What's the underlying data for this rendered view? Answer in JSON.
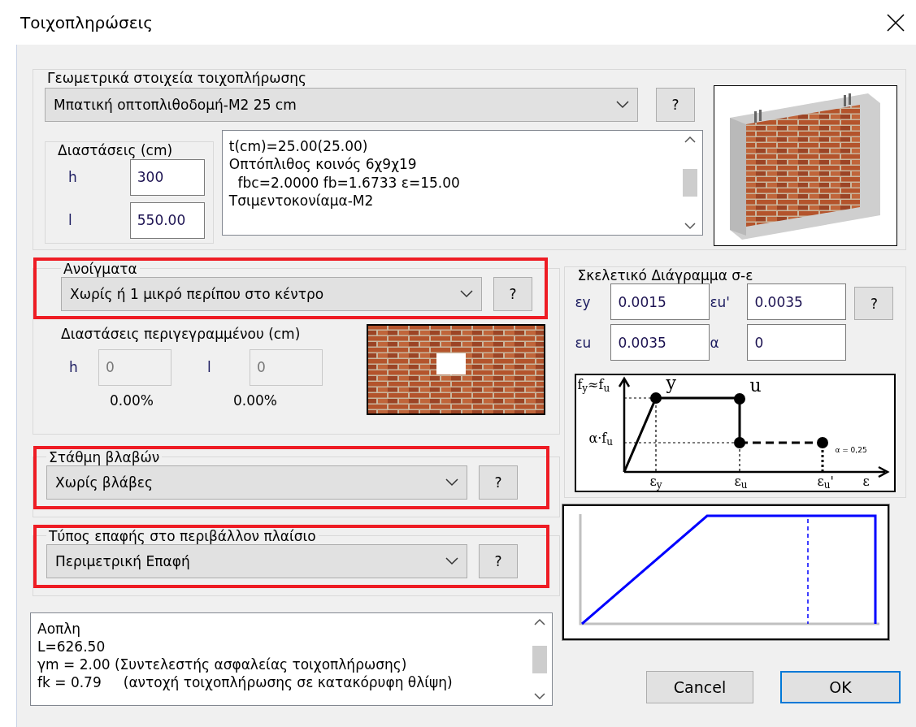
{
  "window": {
    "title": "Τοιχοπληρώσεις"
  },
  "geometry": {
    "title": "Γεωμετρικά στοιχεία τοιχοπλήρωσης",
    "type": "Μπατική οπτοπλιθοδομή-Μ2 25 cm",
    "help": "?",
    "dimensions": {
      "title": "Διαστάσεις (cm)",
      "fields": [
        {
          "label": "h",
          "value": "300"
        },
        {
          "label": "l",
          "value": "550.00"
        }
      ]
    },
    "info_lines": [
      "t(cm)=25.00(25.00)",
      "Οπτόπλιθος κοινός 6χ9χ19",
      "  fbc=2.0000 fb=1.6733 ε=15.00",
      "Τσιμεντοκονίαμα-Μ2"
    ]
  },
  "openings": {
    "title": "Ανοίγματα",
    "highlighted": true,
    "type": "Χωρίς ή 1 μικρό περίπου στο κέντρο",
    "help": "?",
    "outline_title": "Διαστάσεις περιγεγραμμένου (cm)",
    "fields": [
      {
        "label": "h",
        "value": "0",
        "percent": "0.00%",
        "disabled": true
      },
      {
        "label": "l",
        "value": "0",
        "percent": "0.00%",
        "disabled": true
      }
    ]
  },
  "damage": {
    "title": "Στάθμη βλαβών",
    "highlighted": true,
    "type": "Χωρίς βλάβες",
    "help": "?"
  },
  "contact": {
    "title": "Τύπος επαφής στο περιβάλλον πλαίσιο",
    "highlighted": true,
    "type": "Περιμετρική Επαφή",
    "help": "?"
  },
  "notes": [
    "Αοπλη",
    "L=626.50",
    "γm = 2.00 (Συντελεστής ασφαλείας τοιχοπλήρωσης)",
    "fk = 0.79     (αντοχή τοιχοπλήρωσης σε κατακόρυφη θλίψη)"
  ],
  "skeleton": {
    "title": "Σκελετικό Διάγραμμα σ-ε",
    "fields": [
      {
        "label": "εy",
        "value": "0.0015"
      },
      {
        "label": "εu'",
        "value": "0.0035"
      },
      {
        "label": "εu",
        "value": "0.0035"
      },
      {
        "label": "α",
        "value": "0"
      }
    ],
    "help": "?",
    "diagram_labels": [
      "f$_{y}$≈f$_{u}$",
      "y",
      "u",
      "α·f$_{u}$",
      "ε$_{y}$",
      "ε$_{u}$",
      "ε$_{u}$'",
      "ε",
      "α = 0,25"
    ]
  },
  "buttons": [
    {
      "label": "Cancel",
      "default": false
    },
    {
      "label": "OK",
      "default": true
    }
  ]
}
